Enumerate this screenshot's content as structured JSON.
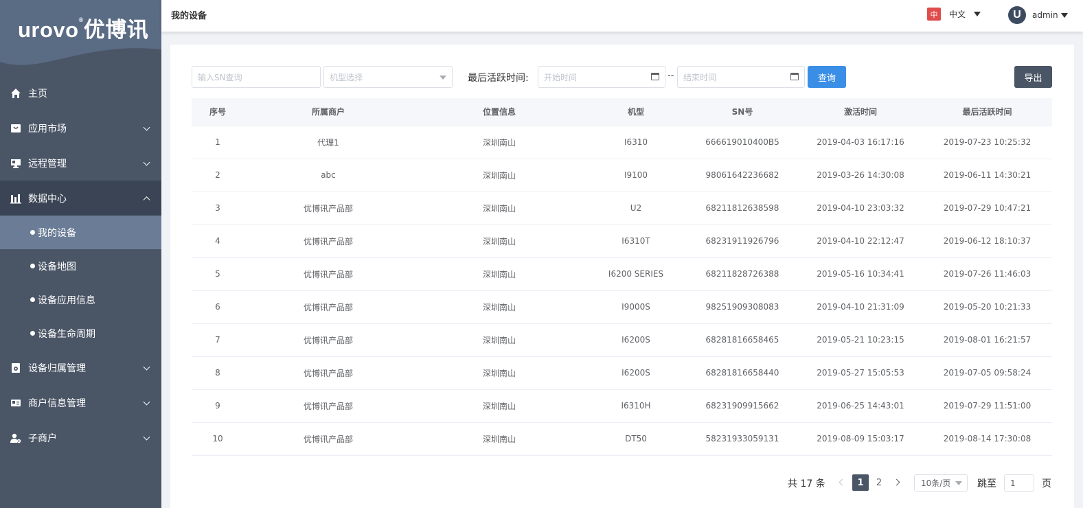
{
  "brand": {
    "logo_text": "urovo",
    "logo_mark": "®",
    "logo_cn": "优博讯"
  },
  "sidebar": {
    "items": [
      {
        "label": "主页",
        "icon": "home-icon"
      },
      {
        "label": "应用市场",
        "icon": "store-icon"
      },
      {
        "label": "远程管理",
        "icon": "monitor-icon"
      },
      {
        "label": "数据中心",
        "icon": "bar-chart-icon"
      },
      {
        "label": "设备归属管理",
        "icon": "device-icon"
      },
      {
        "label": "商户信息管理",
        "icon": "id-card-icon"
      },
      {
        "label": "子商户",
        "icon": "user-gear-icon"
      }
    ],
    "sub_items": [
      "我的设备",
      "设备地图",
      "设备应用信息",
      "设备生命周期"
    ]
  },
  "header": {
    "title": "我的设备",
    "lang_flag": "中",
    "lang_label": "中文",
    "avatar_letter": "U",
    "username": "admin"
  },
  "filters": {
    "sn_placeholder": "输入SN查询",
    "model_placeholder": "机型选择",
    "time_label": "最后活跃时间:",
    "start_placeholder": "开始时间",
    "range_sep": "--",
    "end_placeholder": "结束时间",
    "query_label": "查询",
    "export_label": "导出"
  },
  "table": {
    "headers": [
      "序号",
      "所属商户",
      "位置信息",
      "机型",
      "SN号",
      "激活时间",
      "最后活跃时间"
    ],
    "rows": [
      [
        "1",
        "代理1",
        "深圳南山",
        "I6310",
        "666619010400B5",
        "2019-04-03 16:17:16",
        "2019-07-23 10:25:32"
      ],
      [
        "2",
        "abc",
        "深圳南山",
        "I9100",
        "98061642236682",
        "2019-03-26 14:30:08",
        "2019-06-11 14:30:21"
      ],
      [
        "3",
        "优博讯产品部",
        "深圳南山",
        "U2",
        "68211812638598",
        "2019-04-10 23:03:32",
        "2019-07-29 10:47:21"
      ],
      [
        "4",
        "优博讯产品部",
        "深圳南山",
        "I6310T",
        "68231911926796",
        "2019-04-10 22:12:47",
        "2019-06-12 18:10:37"
      ],
      [
        "5",
        "优博讯产品部",
        "深圳南山",
        "I6200 SERIES",
        "68211828726388",
        "2019-05-16 10:34:41",
        "2019-07-26 11:46:03"
      ],
      [
        "6",
        "优博讯产品部",
        "深圳南山",
        "I9000S",
        "98251909308083",
        "2019-04-10 21:31:09",
        "2019-05-20 10:21:33"
      ],
      [
        "7",
        "优博讯产品部",
        "深圳南山",
        "I6200S",
        "68281816658465",
        "2019-05-21 10:23:15",
        "2019-08-01 16:21:57"
      ],
      [
        "8",
        "优博讯产品部",
        "深圳南山",
        "I6200S",
        "68281816658440",
        "2019-05-27 15:05:53",
        "2019-07-05 09:58:24"
      ],
      [
        "9",
        "优博讯产品部",
        "深圳南山",
        "I6310H",
        "68231909915662",
        "2019-06-25 14:43:01",
        "2019-07-29 11:51:00"
      ],
      [
        "10",
        "优博讯产品部",
        "深圳南山",
        "DT50",
        "58231933059131",
        "2019-08-09 15:03:17",
        "2019-08-14 17:30:08"
      ]
    ]
  },
  "pagination": {
    "total_text": "共 17 条",
    "pages": [
      "1",
      "2"
    ],
    "current_page": "1",
    "page_size": "10条/页",
    "jump_label": "跳至",
    "jump_value": "1",
    "jump_suffix": "页"
  },
  "colors": {
    "sidebar_bg": "#4a5566",
    "primary": "#3a8ee6",
    "export_bg": "#4a5566",
    "lang_flag": "#e04b4b"
  }
}
